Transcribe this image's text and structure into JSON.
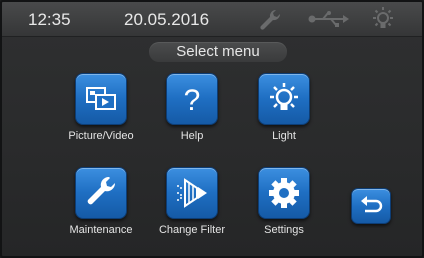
{
  "status_bar": {
    "time": "12:35",
    "date": "20.05.2016",
    "icons": [
      "wrench-icon",
      "usb-icon",
      "light-icon"
    ]
  },
  "menu": {
    "title": "Select menu",
    "items": [
      {
        "label": "Picture/Video",
        "icon": "picture-video-icon"
      },
      {
        "label": "Help",
        "icon": "question-mark-icon"
      },
      {
        "label": "Light",
        "icon": "light-bulb-icon"
      },
      {
        "label": "Maintenance",
        "icon": "wrench-icon"
      },
      {
        "label": "Change Filter",
        "icon": "filter-icon"
      },
      {
        "label": "Settings",
        "icon": "gear-icon"
      }
    ],
    "back_icon": "back-arrow-icon"
  },
  "colors": {
    "button_blue": "#1f6fc3",
    "background": "#2a2b2c",
    "text": "#e6e6e6",
    "status_icon_dim": "#6a6b6c"
  }
}
